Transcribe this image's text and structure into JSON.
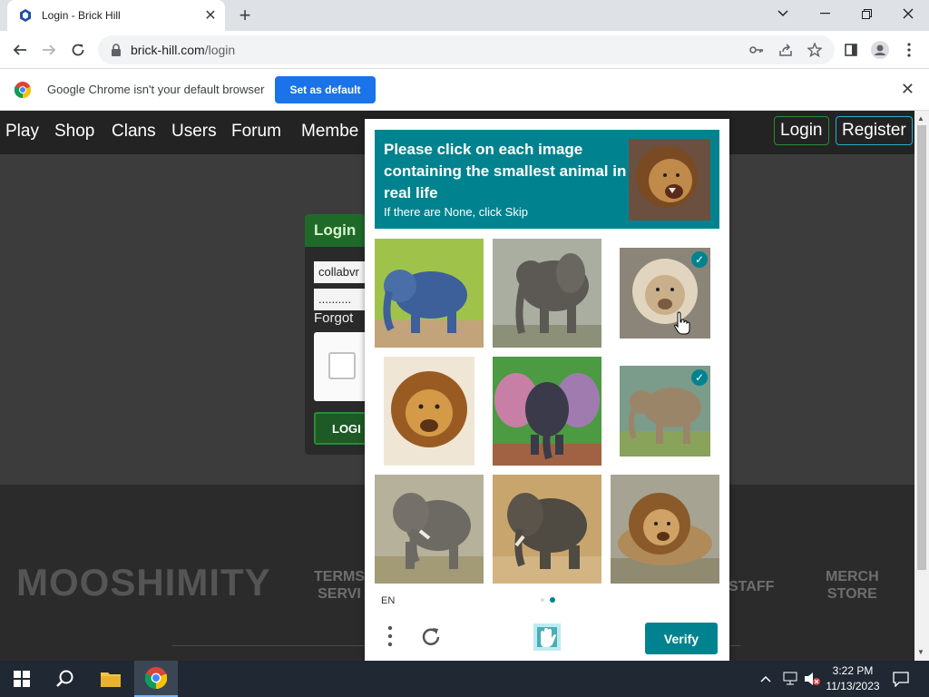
{
  "browser": {
    "tab_title": "Login - Brick Hill",
    "url_host": "brick-hill.com",
    "url_path": "/login",
    "infobar_message": "Google Chrome isn't your default browser",
    "set_default_label": "Set as default"
  },
  "site": {
    "nav": [
      "Play",
      "Shop",
      "Clans",
      "Users",
      "Forum",
      "Membe"
    ],
    "login_label": "Login",
    "register_label": "Register",
    "login_box": {
      "title": "Login",
      "username_value": "collabvr",
      "password_value": "..........",
      "forgot_label": "Forgot",
      "login_button": "LOGI"
    },
    "footer": {
      "logo": "MOOSHIMITY",
      "terms": "TERMS",
      "service": "SERVI",
      "staff": "STAFF",
      "merch": "MERCH",
      "store": "STORE"
    }
  },
  "captcha": {
    "prompt": "Please click on each image containing the smallest animal in real life",
    "subprompt": "If there are None, click Skip",
    "language": "EN",
    "verify_label": "Verify",
    "cells": [
      {
        "animal": "elephant",
        "selected": false
      },
      {
        "animal": "elephant",
        "selected": false
      },
      {
        "animal": "lion",
        "selected": true
      },
      {
        "animal": "lion",
        "selected": false
      },
      {
        "animal": "elephant",
        "selected": false
      },
      {
        "animal": "elephant",
        "selected": true
      },
      {
        "animal": "elephant",
        "selected": false
      },
      {
        "animal": "elephant",
        "selected": false
      },
      {
        "animal": "lion",
        "selected": false
      }
    ]
  },
  "taskbar": {
    "time": "3:22 PM",
    "date": "11/13/2023"
  },
  "colors": {
    "captcha_teal": "#00838f",
    "chrome_blue": "#1a73e8",
    "site_green": "#1f6a29"
  }
}
